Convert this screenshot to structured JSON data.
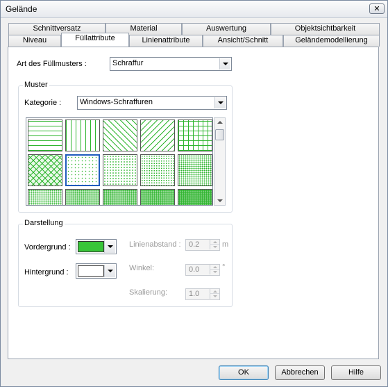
{
  "window": {
    "title": "Gelände",
    "close_symbol": "✕"
  },
  "tabs_row1": [
    "Schnittversatz",
    "Material",
    "Auswertung",
    "Objektsichtbarkeit"
  ],
  "tabs_row2": [
    "Niveau",
    "Füllattribute",
    "Linienattribute",
    "Ansicht/Schnitt",
    "Geländemodellierung"
  ],
  "active_tab": "Füllattribute",
  "fill_type": {
    "label": "Art des Füllmusters :",
    "value": "Schraffur"
  },
  "muster": {
    "group_label": "Muster",
    "category_label": "Kategorie :",
    "category_value": "Windows-Schraffuren",
    "selected_index": 6,
    "pattern_color": "#2db52d"
  },
  "darstellung": {
    "group_label": "Darstellung",
    "foreground_label": "Vordergrund :",
    "foreground_color": "#38c538",
    "background_label": "Hintergrund :",
    "background_color": "#ffffff",
    "line_spacing_label": "Linienabstand :",
    "line_spacing_value": "0.2",
    "line_spacing_unit": "m",
    "angle_label": "Winkel:",
    "angle_value": "0.0",
    "angle_unit": "°",
    "scale_label": "Skalierung:",
    "scale_value": "1.0"
  },
  "buttons": {
    "ok": "OK",
    "cancel": "Abbrechen",
    "help": "Hilfe"
  }
}
